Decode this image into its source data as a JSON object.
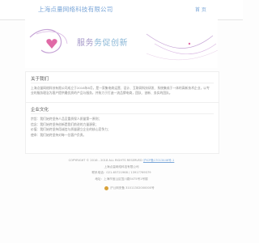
{
  "header": {
    "title": "上海点量网络科技有限公司",
    "nav_home": "首 页"
  },
  "banner": {
    "text_a": "服务",
    "text_b": "务促创新",
    "colors": {
      "swirl": "#c6a4d6",
      "heart": "#e06aa6",
      "swirl2": "#9fb6e3"
    }
  },
  "about": {
    "title": "关于我们",
    "body": "上海点量网络科技有限公司成立于2016年8月，是一家集电商运营、设计、互联网科技研发、系统集成于一体的高新技术企业，以专业的服务理念为客户提供最优质的产品与服务，并致力于打造一流品牌电商，团队、创新、务实的团队。"
  },
  "culture": {
    "title": "企业文化",
    "lines": [
      "宗旨：我们始终坚持人品至重质保人质量第一原则；",
      "信念：我们始终坚持创新是我们前进的力量源泉；",
      "价值：我们始终坚持用诚信与质量建立企业的核心竞争力；",
      "使命：我们始终坚持对每一位客户负责。"
    ]
  },
  "footer": {
    "copyright": "COPYRIGHT © 2016 - 2018 ALL RIGHTS RESERVED",
    "icp": "沪ICP备17013446号-1",
    "company": "上海点量网络科技有限公司",
    "phone": "联系电话：021-65721968 / 13917769379",
    "address": "地址：上海市宝山区蕰川路5475号1号楼",
    "police": "沪公网安备 31011302000000号",
    "colors": {
      "link": "#7aa6d8",
      "badge": "#d8a23a"
    }
  }
}
